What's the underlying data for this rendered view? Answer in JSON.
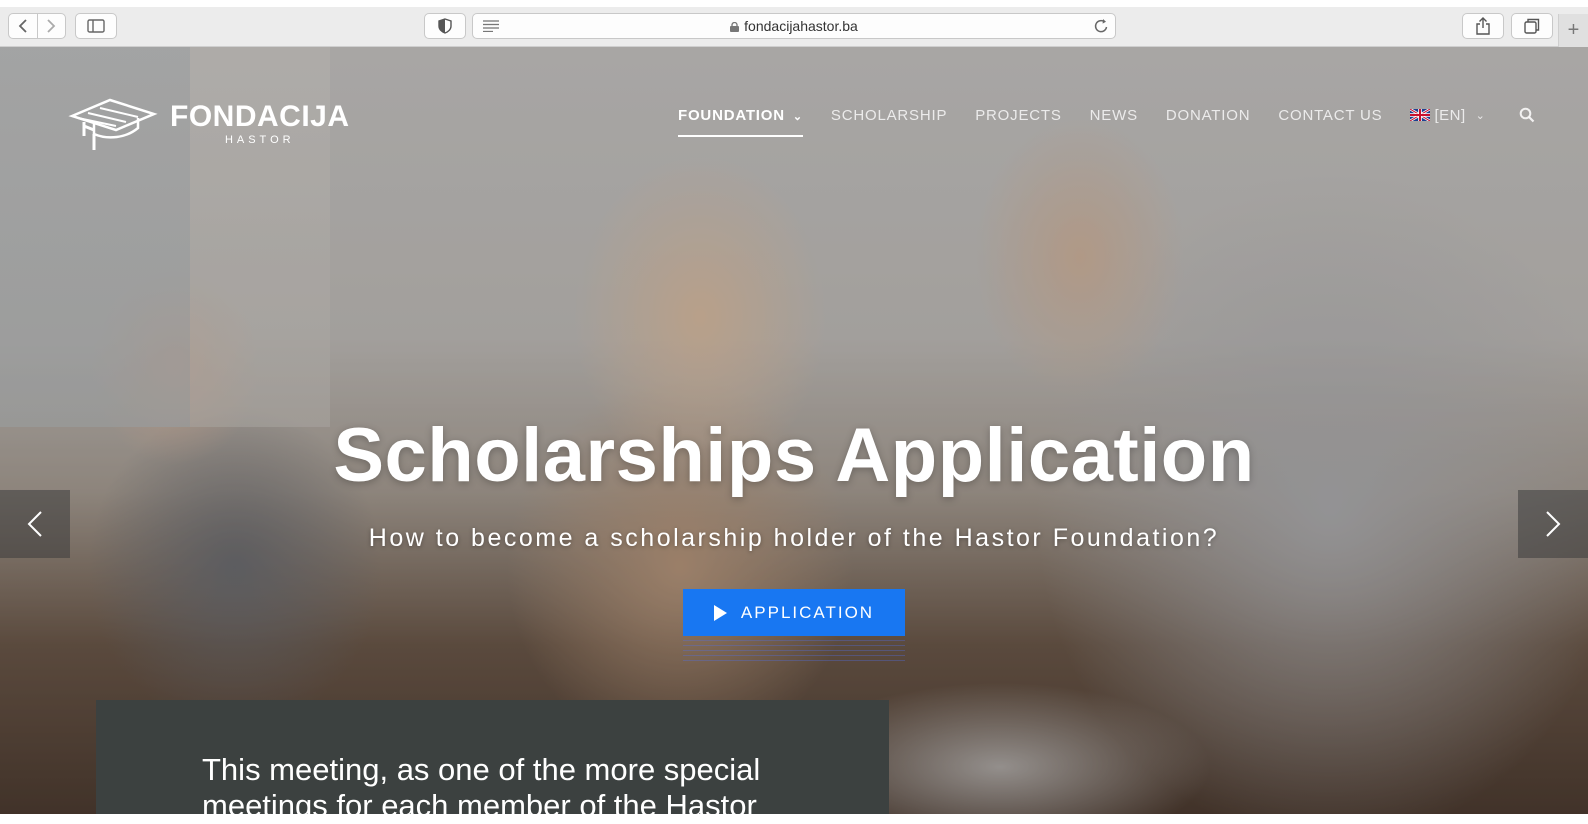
{
  "browser": {
    "url": "fondacijahastor.ba",
    "icons": [
      "chevron-left-icon",
      "chevron-right-icon",
      "sidebar-icon",
      "shield-icon",
      "reader-icon",
      "lock-icon",
      "reload-icon",
      "share-icon",
      "tabs-icon",
      "plus-icon"
    ]
  },
  "site": {
    "logo": {
      "name": "FONDACIJA",
      "sub": "HASTOR"
    },
    "nav": [
      {
        "label": "FOUNDATION",
        "active": true,
        "dropdown": true
      },
      {
        "label": "SCHOLARSHIP"
      },
      {
        "label": "PROJECTS"
      },
      {
        "label": "NEWS"
      },
      {
        "label": "DONATION"
      },
      {
        "label": "CONTACT US"
      }
    ],
    "language": {
      "label": "[EN]",
      "flag": "uk-flag-icon"
    }
  },
  "hero": {
    "title": "Scholarships Application",
    "subtitle": "How to become a scholarship holder of the Hastor Foundation?",
    "button_label": "APPLICATION"
  },
  "panel": {
    "text": "This meeting, as one of the more special meetings for each member of the Hastor"
  },
  "colors": {
    "accent": "#1877f2",
    "panel_bg": "#3c4140",
    "chrome_bg": "#ececec"
  }
}
